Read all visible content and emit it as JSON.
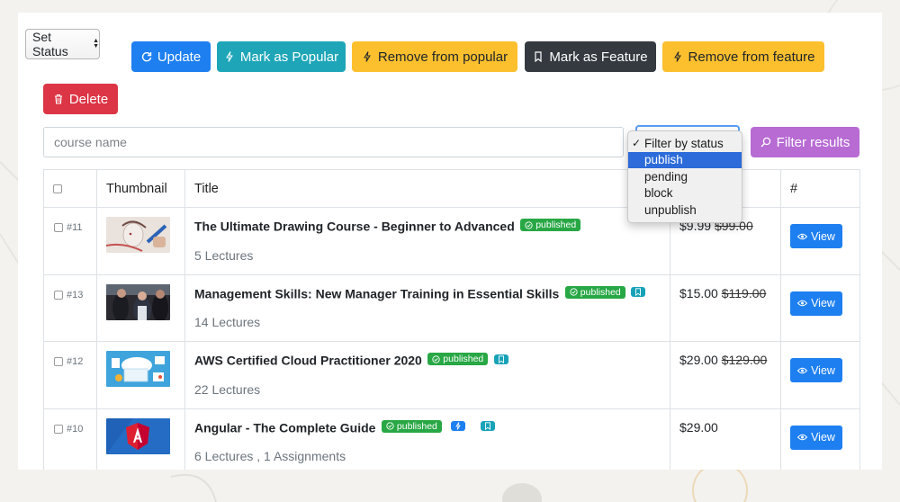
{
  "toolbar": {
    "set_status": "Set Status",
    "update": "Update",
    "mark_popular": "Mark as Popular",
    "remove_popular": "Remove from popular",
    "mark_feature": "Mark as Feature",
    "remove_feature": "Remove from feature",
    "delete": "Delete"
  },
  "search": {
    "placeholder": "course name",
    "value": ""
  },
  "filter": {
    "options": [
      "Filter by status",
      "publish",
      "pending",
      "block",
      "unpublish"
    ],
    "checked_option": "Filter by status",
    "highlighted_option": "publish",
    "button": "Filter results"
  },
  "table": {
    "headers": [
      "",
      "Thumbnail",
      "Title",
      "",
      "#"
    ],
    "rows": [
      {
        "id": "#11",
        "title": "The Ultimate Drawing Course - Beginner to Advanced",
        "status": "published",
        "popular": false,
        "featured": false,
        "meta": "5 Lectures",
        "price": "$9.99",
        "old_price": "$99.00",
        "action": "View"
      },
      {
        "id": "#13",
        "title": "Management Skills: New Manager Training in Essential Skills",
        "status": "published",
        "popular": false,
        "featured": true,
        "meta": "14 Lectures",
        "price": "$15.00",
        "old_price": "$119.00",
        "action": "View"
      },
      {
        "id": "#12",
        "title": "AWS Certified Cloud Practitioner 2020",
        "status": "published",
        "popular": false,
        "featured": true,
        "meta": "22 Lectures",
        "price": "$29.00",
        "old_price": "$129.00",
        "action": "View"
      },
      {
        "id": "#10",
        "title": "Angular - The Complete Guide",
        "status": "published",
        "popular": true,
        "featured": true,
        "meta": "6 Lectures , 1 Assignments",
        "price": "$29.00",
        "old_price": "",
        "action": "View"
      }
    ]
  },
  "colors": {
    "primary": "#1e7ff0",
    "info": "#1ea6b8",
    "warning": "#fcc02e",
    "dark": "#343a40",
    "danger": "#dc3545",
    "purple": "#b76bd3",
    "success": "#28a745"
  }
}
